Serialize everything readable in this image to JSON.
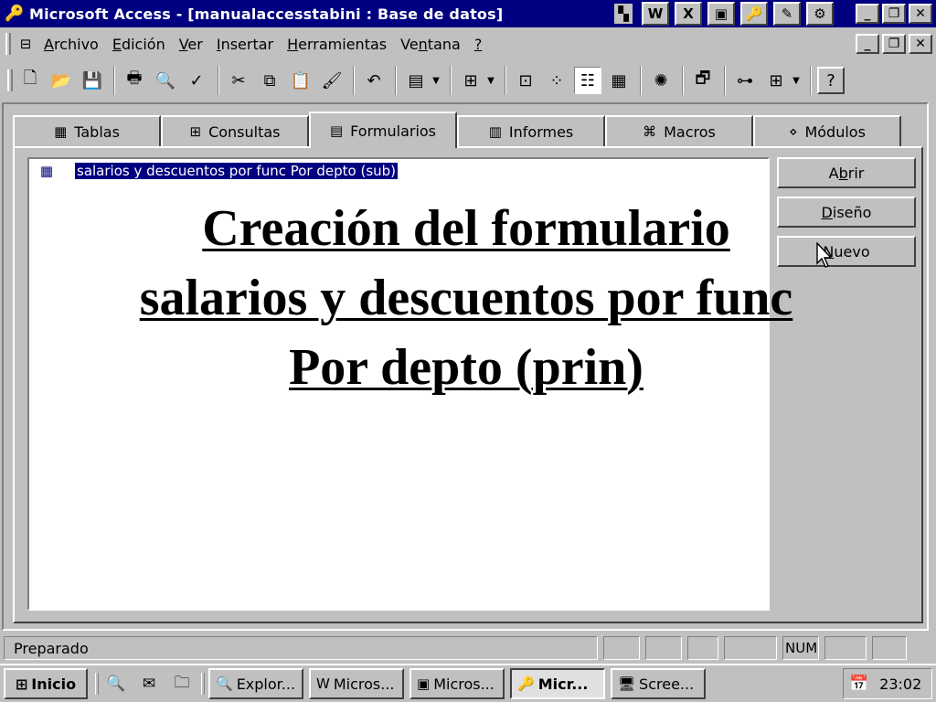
{
  "window": {
    "title": "Microsoft Access - [manualaccesstabini : Base de datos]",
    "app_icon": "key-icon"
  },
  "titlebar_apps": [
    "W",
    "X",
    "▣",
    "🔑",
    "✎",
    "⚙"
  ],
  "menu": {
    "items": [
      {
        "pre": "",
        "ul": "A",
        "post": "rchivo"
      },
      {
        "pre": "",
        "ul": "E",
        "post": "dición"
      },
      {
        "pre": "",
        "ul": "V",
        "post": "er"
      },
      {
        "pre": "",
        "ul": "I",
        "post": "nsertar"
      },
      {
        "pre": "",
        "ul": "H",
        "post": "erramientas"
      },
      {
        "pre": "Ve",
        "ul": "n",
        "post": "tana"
      },
      {
        "pre": "",
        "ul": "?",
        "post": ""
      }
    ]
  },
  "tabs": [
    {
      "label": "Tablas",
      "icon": "▦"
    },
    {
      "label": "Consultas",
      "icon": "⊞"
    },
    {
      "label": "Formularios",
      "icon": "▤"
    },
    {
      "label": "Informes",
      "icon": "▥"
    },
    {
      "label": "Macros",
      "icon": "⌘"
    },
    {
      "label": "Módulos",
      "icon": "⋄"
    }
  ],
  "active_tab": "Formularios",
  "list": {
    "items": [
      {
        "label": "salarios y descuentos por func Por depto (sub)",
        "selected": true
      }
    ]
  },
  "buttons": {
    "open": {
      "pre": "A",
      "ul": "b",
      "post": "rir"
    },
    "design": {
      "pre": "",
      "ul": "D",
      "post": "iseño"
    },
    "new": {
      "pre": "",
      "ul": "N",
      "post": "uevo"
    }
  },
  "caption": {
    "line1": "Creación del formulario",
    "line2": "salarios y descuentos por func",
    "line3": "Por depto (prin)"
  },
  "status": {
    "text": "Preparado",
    "num": "NUM"
  },
  "taskbar": {
    "start": "Inicio",
    "tasks": [
      {
        "label": "Explor...",
        "icon": "🔍",
        "active": false
      },
      {
        "label": "Micros...",
        "icon": "W",
        "active": false
      },
      {
        "label": "Micros...",
        "icon": "▣",
        "active": false
      },
      {
        "label": "Micr...",
        "icon": "🔑",
        "active": true
      },
      {
        "label": "Scree...",
        "icon": "🖥",
        "active": false
      }
    ],
    "clock": "23:02"
  }
}
